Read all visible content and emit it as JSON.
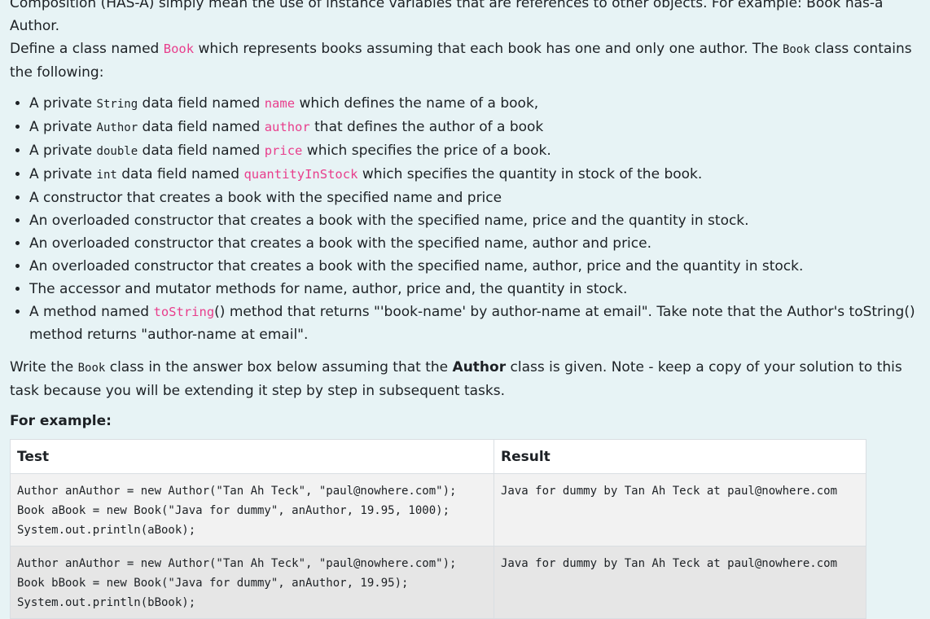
{
  "intro": {
    "line1": "Composition (HAS-A) simply mean the use of instance variables that are references to other objects. For example: Book has-a Author.",
    "line2_a": "Define a class named ",
    "line2_code": "Book",
    "line2_b": " which represents books assuming that each book has one and only one author. The ",
    "line2_code2": "Book",
    "line2_c": " class contains the following:"
  },
  "bullets": [
    {
      "pre": "A private ",
      "type": "String",
      "mid": " data field named ",
      "field": "name",
      "post": " which defines the name of a book,"
    },
    {
      "pre": "A private ",
      "type": "Author",
      "mid": " data field named ",
      "field": "author",
      "post": " that defines the author of a book"
    },
    {
      "pre": "A private ",
      "type": "double",
      "mid": " data field named ",
      "field": "price",
      "post": " which specifies the price of a book."
    },
    {
      "pre": "A private ",
      "type": "int",
      "mid": " data field named ",
      "field": "quantityInStock",
      "post": " which specifies the quantity in stock of the book."
    },
    {
      "text": "A constructor that creates a book with the specified name and price"
    },
    {
      "text": "An overloaded constructor that creates a book with the specified name, price and the quantity in stock."
    },
    {
      "text": "An overloaded constructor that creates a book with the specified name, author and price."
    },
    {
      "text": "An overloaded constructor that creates a book with the specified name, author, price and the quantity in stock."
    },
    {
      "text": "The accessor and mutator methods for name, author, price and, the quantity in stock."
    },
    {
      "pre": "A method named ",
      "method": "toString",
      "post": "() method that returns \"'book-name' by author-name at email\". Take note that the Author's toString() method returns \"author-name at email\"."
    }
  ],
  "write": {
    "a": "Write the ",
    "code": "Book",
    "b": " class in the answer box below assuming that the ",
    "bold": "Author",
    "c": " class is given. Note - keep a copy of your solution to this task because you will be extending it step by step in subsequent tasks."
  },
  "example_title": "For example:",
  "table": {
    "headers": [
      "Test",
      "Result"
    ],
    "rows": [
      {
        "test": "Author anAuthor = new Author(\"Tan Ah Teck\", \"paul@nowhere.com\");\nBook aBook = new Book(\"Java for dummy\", anAuthor, 19.95, 1000);\nSystem.out.println(aBook);",
        "result": "Java for dummy by Tan Ah Teck at paul@nowhere.com"
      },
      {
        "test": "Author anAuthor = new Author(\"Tan Ah Teck\", \"paul@nowhere.com\");\nBook bBook = new Book(\"Java for dummy\", anAuthor, 19.95);\nSystem.out.println(bBook);",
        "result": "Java for dummy by Tan Ah Teck at paul@nowhere.com"
      }
    ]
  }
}
